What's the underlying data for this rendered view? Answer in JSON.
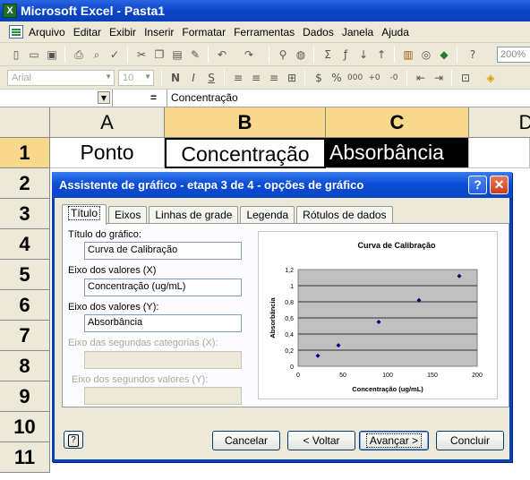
{
  "window": {
    "title": "Microsoft Excel - Pasta1"
  },
  "menu": [
    "Arquivo",
    "Editar",
    "Exibir",
    "Inserir",
    "Formatar",
    "Ferramentas",
    "Dados",
    "Janela",
    "Ajuda"
  ],
  "toolbar": {
    "zoom": "200%",
    "font": "Arial",
    "font_size": "10"
  },
  "formula_bar": {
    "name_box": "",
    "equals": "=",
    "value": "Concentração"
  },
  "sheet": {
    "columns": [
      "A",
      "B",
      "C",
      "D"
    ],
    "rows": [
      "1",
      "2",
      "3",
      "4",
      "5",
      "6",
      "7",
      "8",
      "9",
      "10",
      "11"
    ],
    "cells": {
      "A1": "Ponto",
      "B1": "Concentração",
      "C1": "Absorbância"
    }
  },
  "dialog": {
    "title": "Assistente de gráfico - etapa 3 de 4 - opções de gráfico",
    "help_symbol": "?",
    "close_symbol": "✕",
    "tabs": [
      "Título",
      "Eixos",
      "Linhas de grade",
      "Legenda",
      "Rótulos de dados"
    ],
    "fields": {
      "chart_title_label": "Título do gráfico:",
      "chart_title_value": "Curva de Calibração",
      "x_axis_label": "Eixo dos valores (X)",
      "x_axis_value": "Concentração (ug/mL)",
      "y_axis_label": "Eixo dos valores (Y):",
      "y_axis_value": "Absorbância",
      "x2_label": "Eixo das segundas categorias (X):",
      "y2_label": "Eixo dos segundos valores (Y):"
    },
    "buttons": {
      "help": "?",
      "cancel": "Cancelar",
      "back": "< Voltar",
      "next": "Avançar >",
      "finish": "Concluir"
    }
  },
  "chart_data": {
    "type": "scatter",
    "title": "Curva de Calibração",
    "xlabel": "Concentração (ug/mL)",
    "ylabel": "Absorbância",
    "xlim": [
      0,
      200
    ],
    "ylim": [
      0,
      1.2
    ],
    "xticks": [
      "0",
      "50",
      "100",
      "150",
      "200"
    ],
    "yticks": [
      "0",
      "0,2",
      "0,4",
      "0,6",
      "0,8",
      "1",
      "1,2"
    ],
    "grid": true,
    "x": [
      22,
      45,
      90,
      135,
      180
    ],
    "y": [
      0.13,
      0.26,
      0.55,
      0.82,
      1.12
    ]
  }
}
